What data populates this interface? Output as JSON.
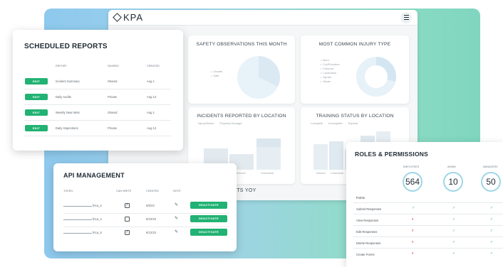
{
  "app": {
    "logo_text": "KPA"
  },
  "dashboard": {
    "safety": {
      "title": "SAFETY OBSERVATIONS THIS MONTH",
      "legend": [
        "Unsafe",
        "Safe"
      ]
    },
    "injury": {
      "title": "MOST COMMON INJURY TYPE",
      "legend": [
        "Burn",
        "Cut/Puncture",
        "Fracture",
        "Laceration",
        "Sprain",
        "Strain"
      ]
    },
    "incidents": {
      "title": "INCIDENTS REPORTED BY LOCATION",
      "legend": [
        "Injury/Illness",
        "Property Damage"
      ],
      "x_labels": [
        "Denver",
        "Columbus"
      ]
    },
    "training": {
      "title": "TRAINING STATUS BY LOCATION",
      "legend": [
        "Complete",
        "Incomplete",
        "Expired"
      ],
      "x_labels": [
        "Denver",
        "Columbus"
      ]
    },
    "partial_heading": "RTS YOY"
  },
  "scheduled_reports": {
    "title": "SCHEDULED REPORTS",
    "headers": [
      "Report",
      "Shared",
      "Created"
    ],
    "button_label": "EDIT",
    "rows": [
      {
        "report": "Incident Summary",
        "shared": "Shared",
        "created": "Aug 1"
      },
      {
        "report": "Daily Audits",
        "shared": "Private",
        "created": "Aug 12"
      },
      {
        "report": "Weekly Near Miss",
        "shared": "Shared",
        "created": "Aug 1"
      },
      {
        "report": "Daily Inspections",
        "shared": "Private",
        "created": "Aug 12"
      }
    ]
  },
  "api_management": {
    "title": "API MANAGEMENT",
    "headers": [
      "Token",
      "Can Write",
      "Created",
      "Note"
    ],
    "button_label": "DEACTIVATE",
    "rows": [
      {
        "token_suffix": "fe1a_2",
        "can_write": true,
        "created": "6/5/23"
      },
      {
        "token_suffix": "fe1a_4",
        "can_write": false,
        "created": "6/10/23"
      },
      {
        "token_suffix": "fe1a_6",
        "can_write": true,
        "created": "6/12/23"
      }
    ]
  },
  "roles_permissions": {
    "title": "ROLES & PERMISSIONS",
    "roles": [
      {
        "name": "EMPLOYEES",
        "count": "564"
      },
      {
        "name": "ADMIN",
        "count": "10"
      },
      {
        "name": "MANAGERS",
        "count": "50"
      }
    ],
    "section_label": "Forms",
    "permissions": [
      {
        "name": "Submit Responses",
        "values": [
          true,
          true,
          true
        ]
      },
      {
        "name": "View Responses",
        "values": [
          false,
          true,
          true
        ]
      },
      {
        "name": "Edit Responses",
        "values": [
          false,
          true,
          true
        ]
      },
      {
        "name": "Delete Responses",
        "values": [
          false,
          true,
          true
        ]
      },
      {
        "name": "Create Forms",
        "values": [
          false,
          true,
          true
        ]
      }
    ]
  },
  "colors": {
    "accent_green": "#22b273",
    "deny_red": "#e04646",
    "chart_blue": "#dbe9f3"
  }
}
